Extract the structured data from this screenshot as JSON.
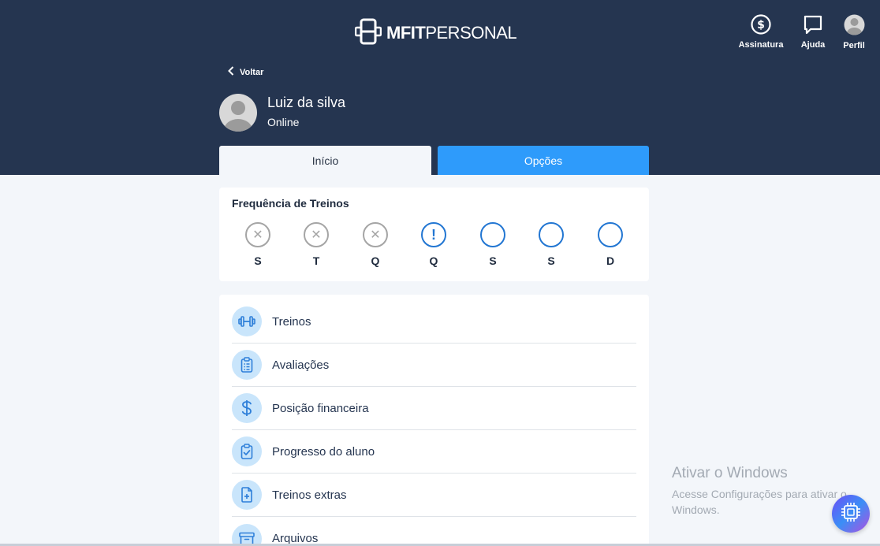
{
  "app": {
    "logo_bold": "MFIT",
    "logo_regular": "PERSONAL"
  },
  "top_nav": {
    "assinatura": "Assinatura",
    "ajuda": "Ajuda",
    "perfil": "Perfil"
  },
  "back_label": "Voltar",
  "student": {
    "name": "Luiz da silva",
    "status": "Online"
  },
  "tabs": {
    "inicio": "Início",
    "opcoes": "Opções"
  },
  "frequency": {
    "title": "Frequência de Treinos",
    "days": [
      {
        "label": "S",
        "state": "missed"
      },
      {
        "label": "T",
        "state": "missed"
      },
      {
        "label": "Q",
        "state": "missed"
      },
      {
        "label": "Q",
        "state": "today"
      },
      {
        "label": "S",
        "state": "pending"
      },
      {
        "label": "S",
        "state": "pending"
      },
      {
        "label": "D",
        "state": "pending"
      }
    ],
    "missed_glyph": "✕",
    "today_glyph": "!"
  },
  "menu": {
    "items": [
      {
        "label": "Treinos",
        "icon": "dumbbell-icon"
      },
      {
        "label": "Avaliações",
        "icon": "clipboard-icon"
      },
      {
        "label": "Posição financeira",
        "icon": "dollar-icon"
      },
      {
        "label": "Progresso do aluno",
        "icon": "clipboard-check-icon"
      },
      {
        "label": "Treinos extras",
        "icon": "file-plus-icon"
      },
      {
        "label": "Arquivos",
        "icon": "archive-icon"
      }
    ]
  },
  "watermark": {
    "title": "Ativar o Windows",
    "line1": "Acesse Configurações para ativar o",
    "line2": "Windows."
  },
  "colors": {
    "header_bg": "#253550",
    "accent_blue": "#2e9bfb",
    "circle_blue": "#2276d2",
    "icon_bg": "#c9e5fb"
  }
}
